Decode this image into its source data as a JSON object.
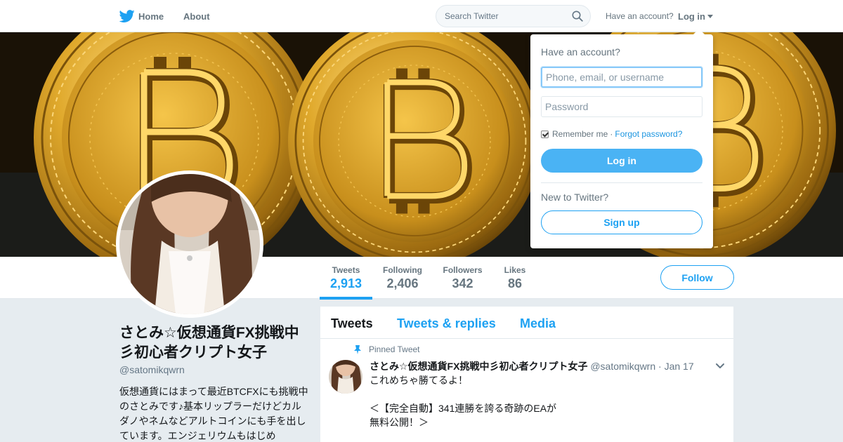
{
  "nav": {
    "home_label": "Home",
    "about_label": "About",
    "search_placeholder": "Search Twitter",
    "have_account_text": "Have an account?",
    "login_label": "Log in"
  },
  "colors": {
    "brand_blue": "#1da1f2",
    "login_button": "#4ab3f4",
    "coin_gold": "#d9a227",
    "background": "#e6ecf0"
  },
  "icons": {
    "brand": "twitter-bird-icon",
    "search": "search-icon",
    "dropdown": "caret-down-icon",
    "pin": "pin-icon",
    "tweet_menu": "chevron-down-icon"
  },
  "stats": [
    {
      "label": "Tweets",
      "value": "2,913"
    },
    {
      "label": "Following",
      "value": "2,406"
    },
    {
      "label": "Followers",
      "value": "342"
    },
    {
      "label": "Likes",
      "value": "86"
    }
  ],
  "follow_label": "Follow",
  "profile": {
    "name": "さとみ☆仮想通貨FX挑戦中彡初心者クリプト女子",
    "handle": "@satomikqwrn",
    "bio": "仮想通貨にはまって最近BTCFXにも挑戦中のさとみです♪基本リップラーだけどカルダノやネムなどアルトコインにも手を出しています。エンジェリウムもはじめ"
  },
  "timeline": {
    "tabs": [
      "Tweets",
      "Tweets & replies",
      "Media"
    ]
  },
  "tweet": {
    "pinned_label": "Pinned Tweet",
    "name": "さとみ☆仮想通貨FX挑戦中彡初心者クリプト女子",
    "handle": "@satomikqwrn",
    "dot": "·",
    "date": "Jan 17",
    "text": "これめちゃ勝てるよ！\n\n＜【完全自動】341連勝を誇る奇跡のEAが\n無料公開！＞"
  },
  "login_dropdown": {
    "heading": "Have an account?",
    "username_placeholder": "Phone, email, or username",
    "password_placeholder": "Password",
    "remember_label": "Remember me",
    "separator": "·",
    "forgot_label": "Forgot password?",
    "login_button": "Log in",
    "new_text": "New to Twitter?",
    "signup_button": "Sign up"
  }
}
